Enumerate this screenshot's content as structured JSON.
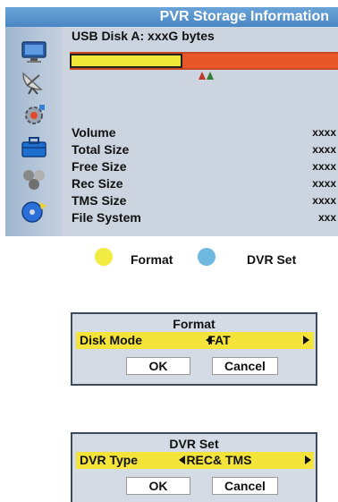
{
  "screen": {
    "title": "PVR Storage Information",
    "usb_label": "USB Disk A: xxxG bytes",
    "usage_fraction": 0.42,
    "sidebar_icons": [
      "monitor-icon",
      "satellite-dish-icon",
      "settings-gear-icon",
      "toolbox-icon",
      "games-icon",
      "media-disc-icon"
    ],
    "info_rows": [
      {
        "label": "Volume",
        "value": "xxxx"
      },
      {
        "label": "Total Size",
        "value": "xxxx"
      },
      {
        "label": "Free Size",
        "value": "xxxx"
      },
      {
        "label": "Rec Size",
        "value": "xxxx"
      },
      {
        "label": "TMS Size",
        "value": "xxxx"
      },
      {
        "label": "File System",
        "value": "xxx"
      }
    ],
    "colors": {
      "used": "#f0e838",
      "free": "#e8572a",
      "title_bar": "#5a94cc"
    }
  },
  "keys": {
    "yellow_label": "Format",
    "yellow_color": "#f2ec42",
    "blue_label": "DVR Set",
    "blue_color": "#6fb8e0"
  },
  "format_dialog": {
    "title": "Format",
    "row_label": "Disk Mode",
    "row_value": "FAT",
    "ok_label": "OK",
    "cancel_label": "Cancel"
  },
  "dvr_dialog": {
    "title": "DVR Set",
    "row_label": "DVR Type",
    "row_value": "REC& TMS",
    "ok_label": "OK",
    "cancel_label": "Cancel"
  }
}
